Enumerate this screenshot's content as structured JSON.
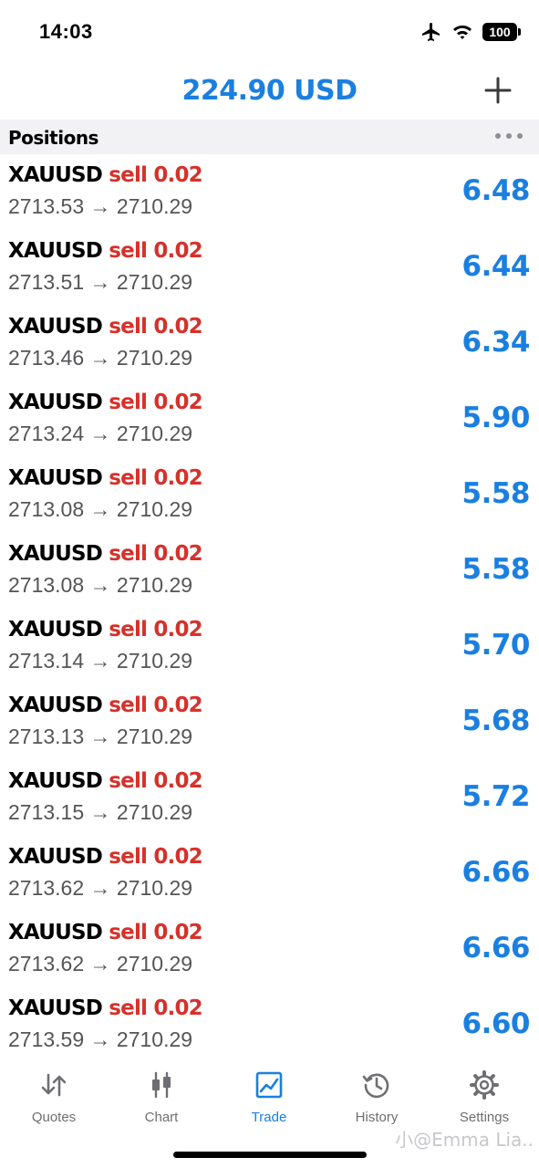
{
  "status_bar": {
    "time": "14:03",
    "battery": "100"
  },
  "header": {
    "balance": "224.90 USD"
  },
  "section": {
    "title": "Positions"
  },
  "positions": [
    {
      "symbol": "XAUUSD",
      "type": "sell 0.02",
      "prices": "2713.53 → 2710.29",
      "profit": "6.48"
    },
    {
      "symbol": "XAUUSD",
      "type": "sell 0.02",
      "prices": "2713.51 → 2710.29",
      "profit": "6.44"
    },
    {
      "symbol": "XAUUSD",
      "type": "sell 0.02",
      "prices": "2713.46 → 2710.29",
      "profit": "6.34"
    },
    {
      "symbol": "XAUUSD",
      "type": "sell 0.02",
      "prices": "2713.24 → 2710.29",
      "profit": "5.90"
    },
    {
      "symbol": "XAUUSD",
      "type": "sell 0.02",
      "prices": "2713.08 → 2710.29",
      "profit": "5.58"
    },
    {
      "symbol": "XAUUSD",
      "type": "sell 0.02",
      "prices": "2713.08 → 2710.29",
      "profit": "5.58"
    },
    {
      "symbol": "XAUUSD",
      "type": "sell 0.02",
      "prices": "2713.14 → 2710.29",
      "profit": "5.70"
    },
    {
      "symbol": "XAUUSD",
      "type": "sell 0.02",
      "prices": "2713.13 → 2710.29",
      "profit": "5.68"
    },
    {
      "symbol": "XAUUSD",
      "type": "sell 0.02",
      "prices": "2713.15 → 2710.29",
      "profit": "5.72"
    },
    {
      "symbol": "XAUUSD",
      "type": "sell 0.02",
      "prices": "2713.62 → 2710.29",
      "profit": "6.66"
    },
    {
      "symbol": "XAUUSD",
      "type": "sell 0.02",
      "prices": "2713.62 → 2710.29",
      "profit": "6.66"
    },
    {
      "symbol": "XAUUSD",
      "type": "sell 0.02",
      "prices": "2713.59 → 2710.29",
      "profit": "6.60"
    }
  ],
  "tabs": [
    {
      "label": "Quotes",
      "icon": "quotes-icon"
    },
    {
      "label": "Chart",
      "icon": "chart-icon"
    },
    {
      "label": "Trade",
      "icon": "trade-icon",
      "active": true
    },
    {
      "label": "History",
      "icon": "history-icon"
    },
    {
      "label": "Settings",
      "icon": "gear-icon"
    }
  ],
  "watermark": "小@Emma Lia..",
  "colors": {
    "accent": "#1a7fe0",
    "sell": "#d6312b",
    "muted": "#6e6e73"
  }
}
